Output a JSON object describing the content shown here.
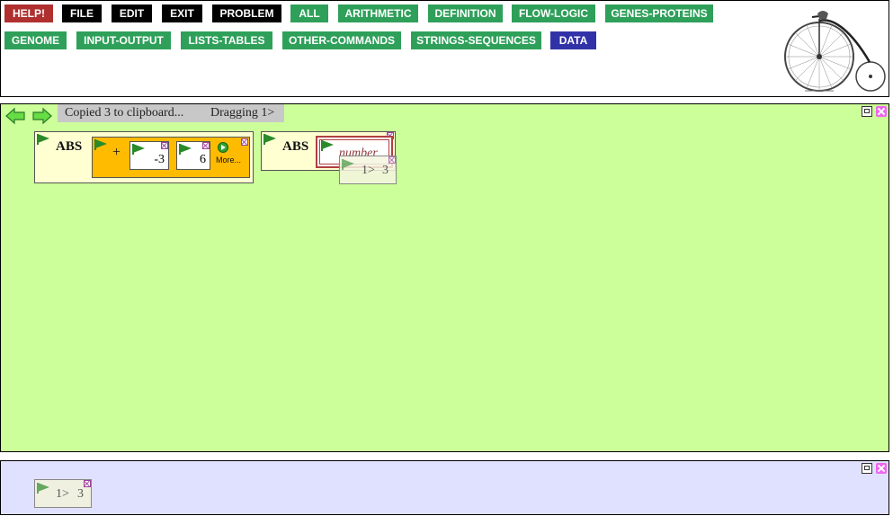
{
  "menu": {
    "row1": [
      {
        "label": "HELP!",
        "style": "help"
      },
      {
        "label": "FILE",
        "style": "black"
      },
      {
        "label": "EDIT",
        "style": "black"
      },
      {
        "label": "EXIT",
        "style": "black"
      },
      {
        "label": "PROBLEM",
        "style": "black"
      },
      {
        "label": "ALL",
        "style": "green"
      },
      {
        "label": "ARITHMETIC",
        "style": "green"
      },
      {
        "label": "DEFINITION",
        "style": "green"
      },
      {
        "label": "FLOW-LOGIC",
        "style": "green"
      },
      {
        "label": "GENES-PROTEINS",
        "style": "green"
      }
    ],
    "row2": [
      {
        "label": "GENOME",
        "style": "green"
      },
      {
        "label": "INPUT-OUTPUT",
        "style": "green"
      },
      {
        "label": "LISTS-TABLES",
        "style": "green"
      },
      {
        "label": "OTHER-COMMANDS",
        "style": "green"
      },
      {
        "label": "STRINGS-SEQUENCES",
        "style": "green"
      },
      {
        "label": "DATA",
        "style": "data"
      }
    ]
  },
  "colors": {
    "workspace_bg": "#ccff99",
    "clipboard_bg": "#e0e0ff",
    "help": "#b03030",
    "category_green": "#2fa05a",
    "data_blue": "#3232a8"
  },
  "workspace": {
    "status_copied": "Copied 3 to clipboard...",
    "status_dragging": "Dragging 1>",
    "back_icon": "back-arrow-icon",
    "forward_icon": "forward-arrow-icon"
  },
  "blocks": {
    "abs1": {
      "keyword": "ABS",
      "plus": {
        "operator": "+",
        "arg1": "-3",
        "arg2": "6",
        "more_label": "More..."
      }
    },
    "abs2": {
      "keyword": "ABS",
      "placeholder": "number"
    },
    "drag_ghost": {
      "prefix": "1>",
      "value": "3"
    }
  },
  "clipboard": {
    "item_prefix": "1>",
    "item_value": "3"
  }
}
